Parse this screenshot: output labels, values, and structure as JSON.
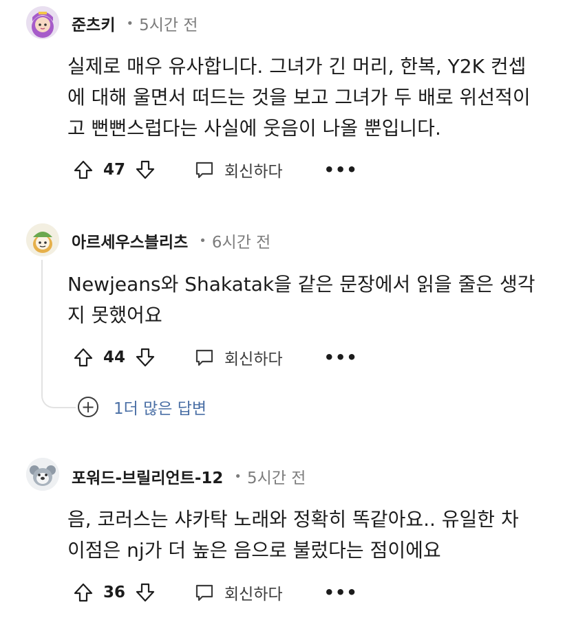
{
  "comments": [
    {
      "username": "준츠키",
      "time": "5시간 전",
      "avatar_icon": "purple-hair-anime-avatar-icon",
      "lines": [
        "실제로 매우 유사합니다. 그녀가 긴 머리, 한복, Y2K 컨셉",
        "에 대해 울면서 떠드는 것을 보고 그녀가 두 배로 위선적이",
        "고 뻔뻔스럽다는 사실에 웃음이 나올 뿐입니다."
      ],
      "score": "47",
      "reply_label": "회신하다",
      "more_label": "•••"
    },
    {
      "username": "아르세우스블리츠",
      "time": "6시간 전",
      "avatar_icon": "green-hat-snoo-avatar-icon",
      "lines": [
        "Newjeans와 Shakatak을 같은 문장에서 읽을 줄은 생각",
        "지 못했어요"
      ],
      "score": "44",
      "reply_label": "회신하다",
      "more_label": "•••"
    },
    {
      "username": "포워드-브릴리언트-12",
      "time": "5시간 전",
      "avatar_icon": "koala-snoo-avatar-icon",
      "lines": [
        "음, 코러스는 샤카탁 노래와 정확히 똑같아요.. 유일한 차",
        "이점은 nj가 더 높은 음으로 불렀다는 점이에요"
      ],
      "score": "36",
      "reply_label": "회신하다",
      "more_label": "•••"
    }
  ],
  "more_replies": {
    "symbol": "+",
    "label": "1더 많은 답변"
  },
  "colors": {
    "text": "#1c1c1c",
    "meta": "#7c7c7c",
    "link": "#4a6fa5",
    "thread_line": "#e2e2e2"
  }
}
